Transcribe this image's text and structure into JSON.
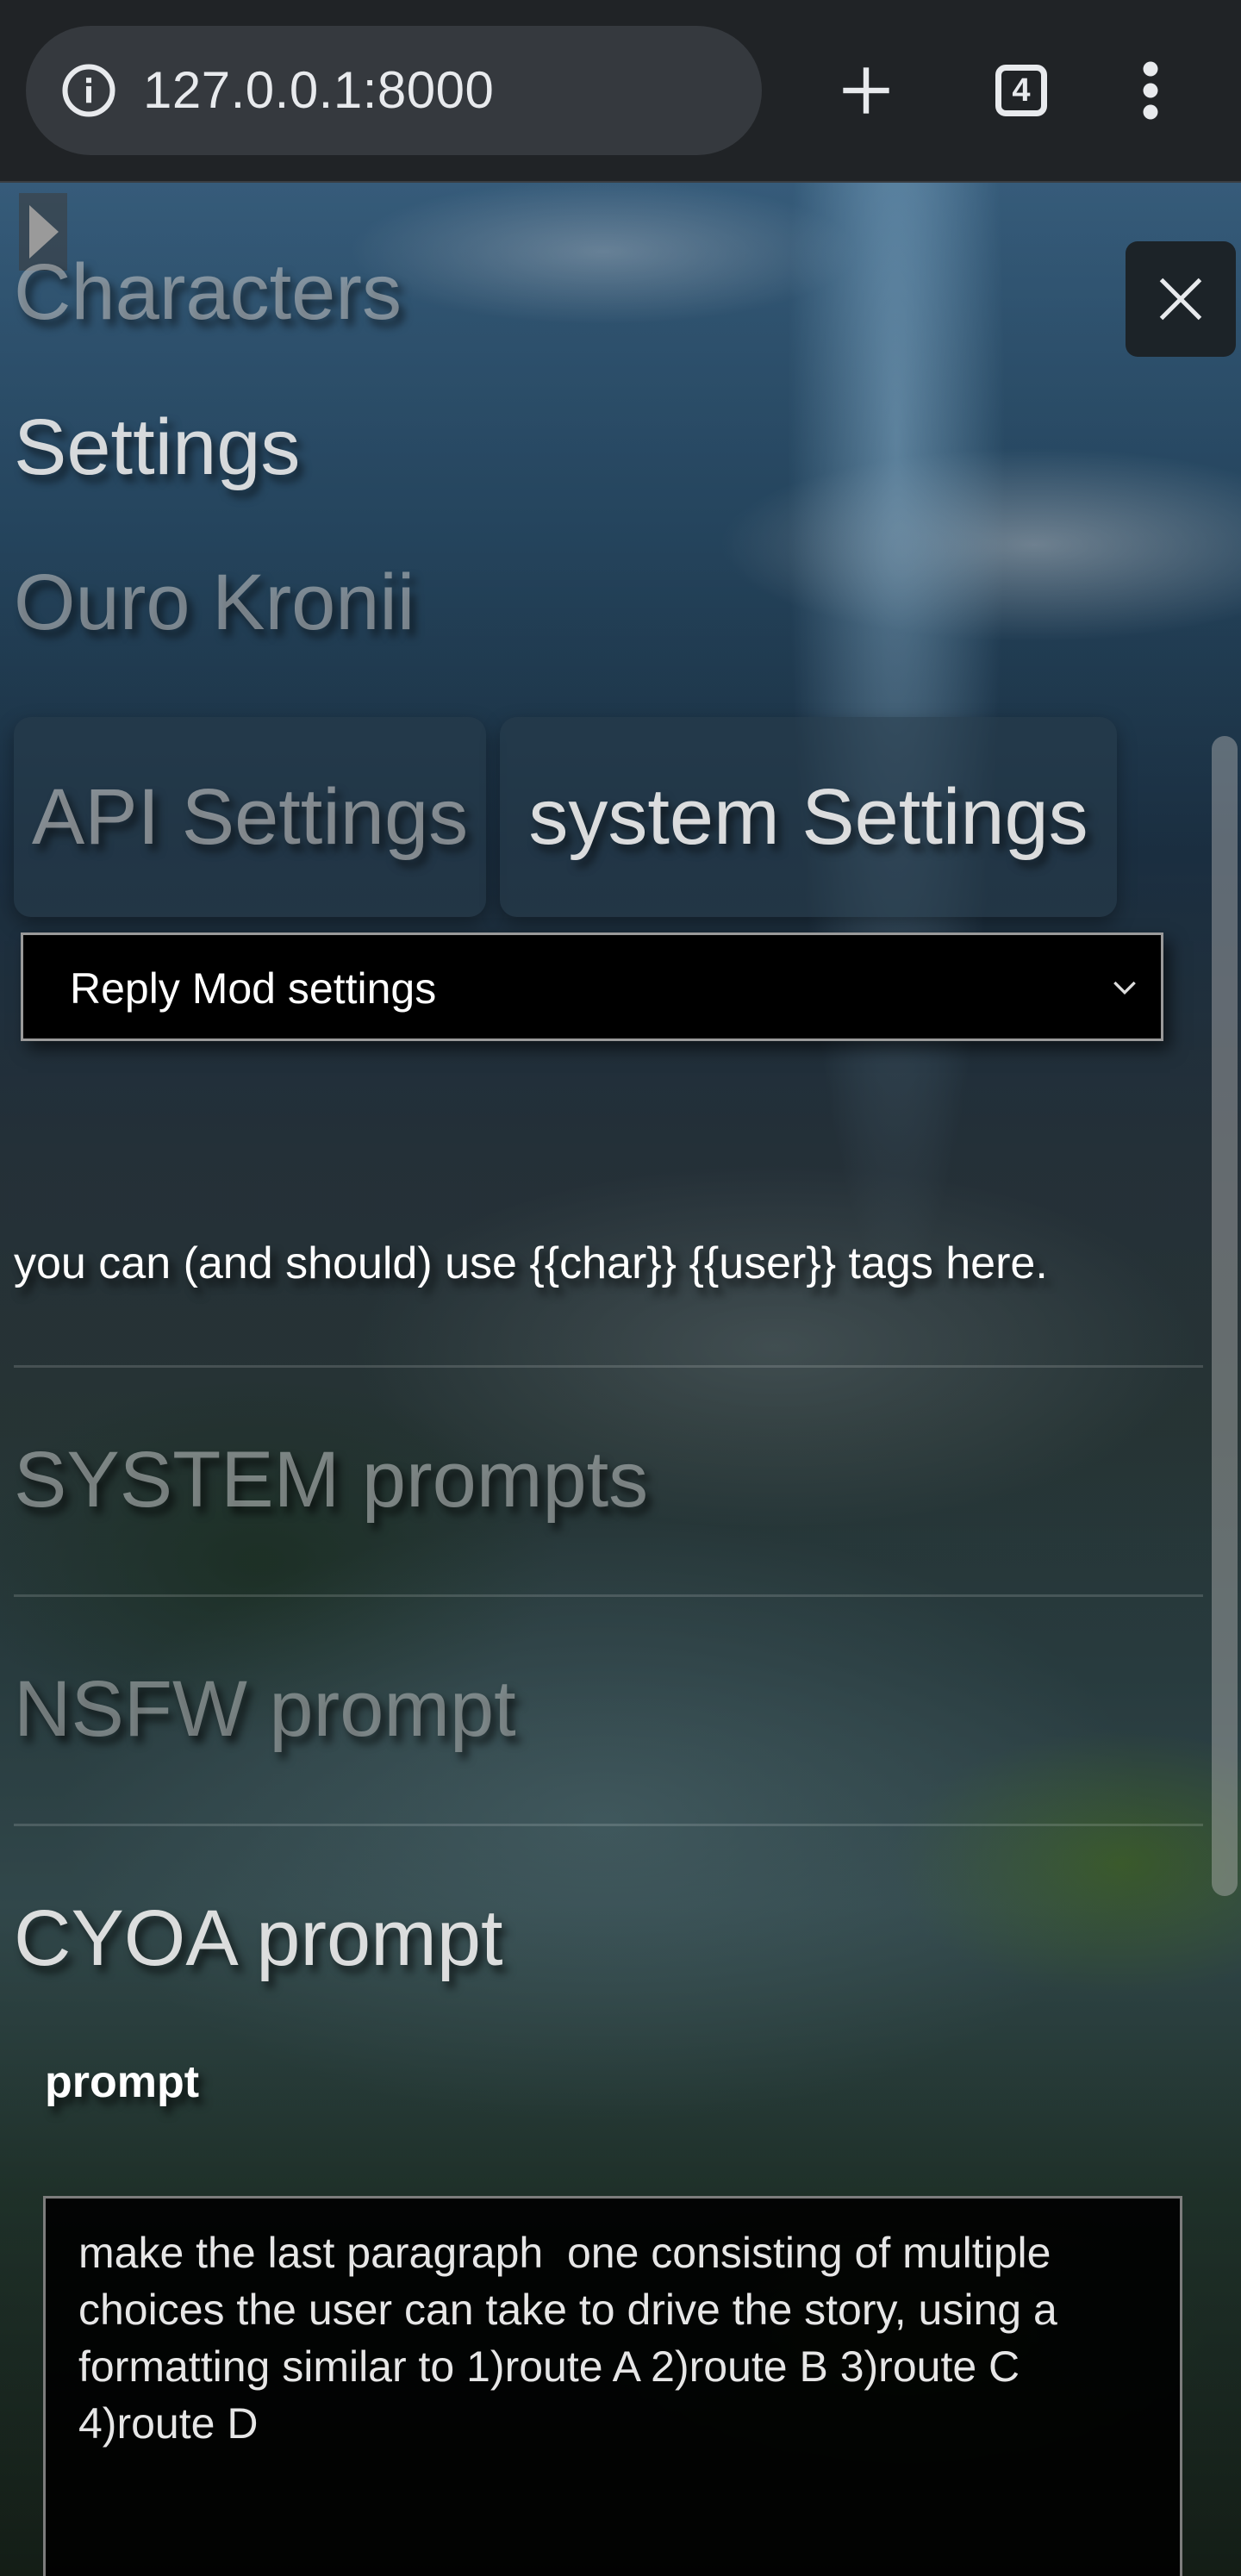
{
  "browser": {
    "url": "127.0.0.1:8000",
    "tab_count": "4",
    "icons": {
      "site_info": "info-circle-icon",
      "new_tab": "plus-icon",
      "tabs": "tab-switcher-icon",
      "menu": "more-vert-icon"
    }
  },
  "nav": {
    "characters": "Characters",
    "settings": "Settings",
    "character_name": "Ouro Kronii"
  },
  "tabs": {
    "api": "API Settings",
    "system": "system Settings"
  },
  "select": {
    "value": "Reply Mod settings"
  },
  "hint": "you can (and should) use {{char}} {{user}} tags here.",
  "sections": {
    "system_prompts": "SYSTEM prompts",
    "nsfw_prompt": "NSFW prompt",
    "cyoa_prompt": "CYOA prompt"
  },
  "cyoa": {
    "field_label": "prompt",
    "value": "make the last paragraph  one consisting of multiple choices the user can take to drive the story, using a formatting similar to 1)route A 2)route B 3)route C 4)route D"
  }
}
